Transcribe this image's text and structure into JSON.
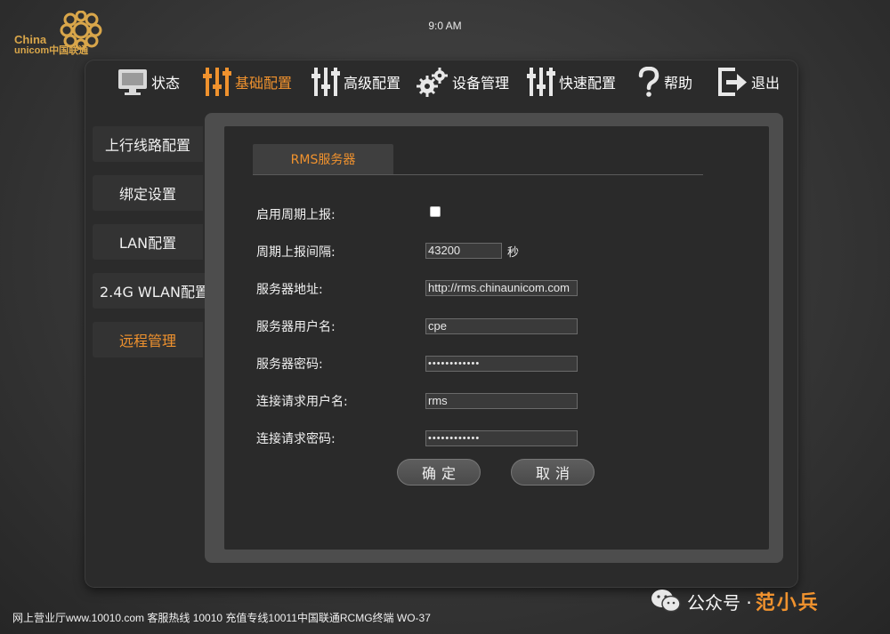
{
  "status_bar": {
    "time": "9:0 AM"
  },
  "logo": {
    "line1": "China",
    "line2": "unicom中国联通"
  },
  "nav": [
    {
      "label": "状态",
      "icon": "monitor-icon"
    },
    {
      "label": "基础配置",
      "icon": "sliders-icon",
      "active": true
    },
    {
      "label": "高级配置",
      "icon": "sliders-icon"
    },
    {
      "label": "设备管理",
      "icon": "gears-icon"
    },
    {
      "label": "快速配置",
      "icon": "sliders-icon"
    },
    {
      "label": "帮助",
      "icon": "question-icon"
    },
    {
      "label": "退出",
      "icon": "exit-icon"
    }
  ],
  "sidebar": [
    {
      "label": "上行线路配置"
    },
    {
      "label": "绑定设置"
    },
    {
      "label": "LAN配置"
    },
    {
      "label": "2.4G WLAN配置"
    },
    {
      "label": "远程管理",
      "active": true
    }
  ],
  "tab": {
    "label": "RMS服务器"
  },
  "form": {
    "periodic_report_label": "启用周期上报:",
    "periodic_report_checked": false,
    "interval_label": "周期上报间隔:",
    "interval_value": "43200",
    "interval_unit": "秒",
    "server_url_label": "服务器地址:",
    "server_url_value": "http://rms.chinaunicom.com",
    "server_user_label": "服务器用户名:",
    "server_user_value": "cpe",
    "server_pwd_label": "服务器密码:",
    "server_pwd_value": "••••••••••••",
    "conn_user_label": "连接请求用户名:",
    "conn_user_value": "rms",
    "conn_pwd_label": "连接请求密码:",
    "conn_pwd_value": "••••••••••••"
  },
  "buttons": {
    "ok": "确定",
    "cancel": "取消"
  },
  "footer": {
    "text": "网上营业厅www.10010.com 客服热线 10010 充值专线10011中国联通RCMG终端 WO-37"
  },
  "watermark": {
    "text": "公众号 · ",
    "name": "范小兵"
  },
  "colors": {
    "accent": "#f0922e",
    "panel": "#2a2a2a",
    "panel_border": "#4d4d4d"
  }
}
